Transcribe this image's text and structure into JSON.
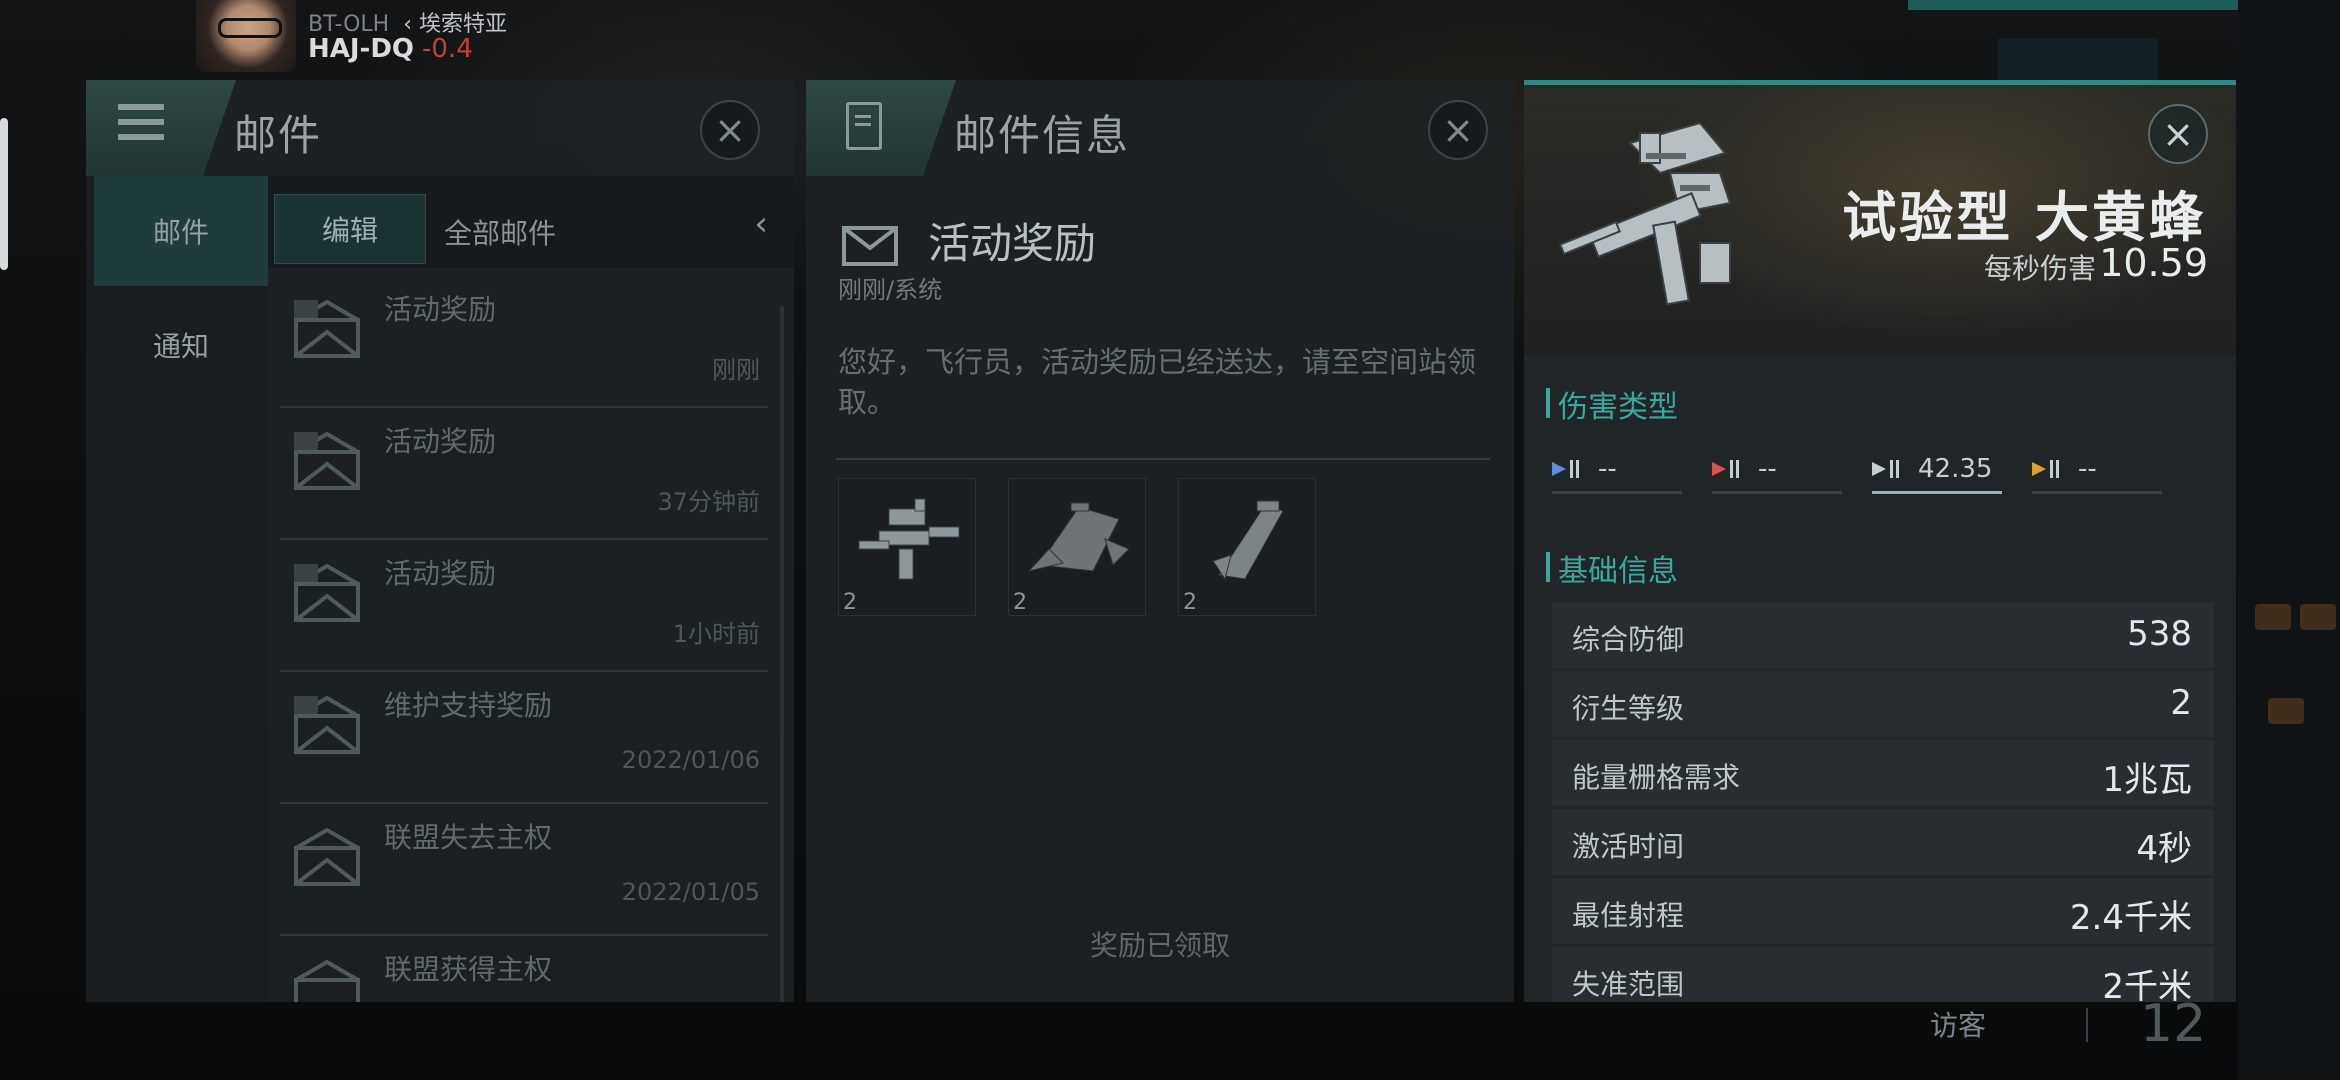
{
  "player": {
    "system": "BT-OLH",
    "region": "埃索特亚",
    "location": "HAJ-DQ",
    "security": "-0.4"
  },
  "mail_panel": {
    "title": "邮件",
    "left_tabs": [
      {
        "label": "邮件",
        "active": true
      },
      {
        "label": "通知",
        "active": false
      }
    ],
    "edit_label": "编辑",
    "filter_label": "全部邮件",
    "collapse_icon": "chevron-left-icon",
    "items": [
      {
        "title": "活动奖励",
        "time": "刚刚"
      },
      {
        "title": "活动奖励",
        "time": "37分钟前"
      },
      {
        "title": "活动奖励",
        "time": "1小时前"
      },
      {
        "title": "维护支持奖励",
        "time": "2022/01/06"
      },
      {
        "title": "联盟失去主权",
        "time": "2022/01/05"
      },
      {
        "title": "联盟获得主权",
        "time": ""
      }
    ]
  },
  "mail_detail": {
    "title": "邮件信息",
    "subject": "活动奖励",
    "meta": "刚刚/系统",
    "body": "您好，飞行员，活动奖励已经送达，请至空间站领取。",
    "attachments": [
      {
        "count": "2"
      },
      {
        "count": "2"
      },
      {
        "count": "2"
      }
    ],
    "status": "奖励已领取"
  },
  "item_detail": {
    "name": "试验型 大黄蜂",
    "dps_label": "每秒伤害",
    "dps_value": "10.59",
    "damage_section": "伤害类型",
    "damage_types": [
      {
        "icon": "em-damage-icon",
        "value": "--",
        "color": "#5b8fd9",
        "active": false
      },
      {
        "icon": "thermal-damage-icon",
        "value": "--",
        "color": "#d9534f",
        "active": false
      },
      {
        "icon": "kinetic-damage-icon",
        "value": "42.35",
        "color": "#c7ced0",
        "active": true
      },
      {
        "icon": "explosive-damage-icon",
        "value": "--",
        "color": "#e0a030",
        "active": false
      }
    ],
    "basic_section": "基础信息",
    "stats": [
      {
        "label": "综合防御",
        "value": "538"
      },
      {
        "label": "衍生等级",
        "value": "2"
      },
      {
        "label": "能量栅格需求",
        "value": "1兆瓦"
      },
      {
        "label": "激活时间",
        "value": "4秒"
      },
      {
        "label": "最佳射程",
        "value": "2.4千米"
      },
      {
        "label": "失准范围",
        "value": "2千米"
      }
    ]
  },
  "visitor": {
    "label": "访客",
    "count": "12"
  },
  "colors": {
    "accent": "#3aa89f",
    "panel": "#1d2123",
    "security_low": "#c2423b"
  }
}
